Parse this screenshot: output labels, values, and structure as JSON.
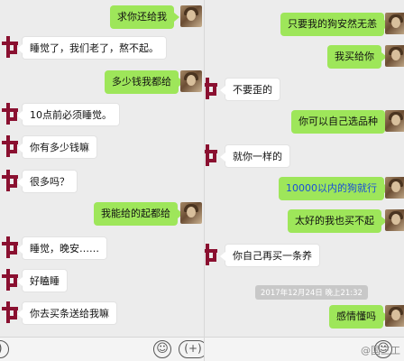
{
  "left_pane": {
    "messages": [
      {
        "from": "me",
        "text": "求你还给我"
      },
      {
        "from": "her",
        "text": "睡觉了，我们老了，熬不起。"
      },
      {
        "from": "me",
        "text": "多少钱我都给"
      },
      {
        "from": "her",
        "text": "10点前必须睡觉。"
      },
      {
        "from": "her",
        "text": "你有多少钱嘛"
      },
      {
        "from": "her",
        "text": "很多吗？"
      },
      {
        "from": "me",
        "text": "我能给的起都给"
      },
      {
        "from": "her",
        "text": "睡觉，晚安……"
      },
      {
        "from": "her",
        "text": "好瞌睡"
      },
      {
        "from": "her",
        "text": "你去买条送给我嘛"
      }
    ]
  },
  "right_pane": {
    "messages": [
      {
        "from": "me",
        "text": "只要我的狗安然无恙"
      },
      {
        "from": "me",
        "text": "我买给你"
      },
      {
        "from": "her",
        "text": "不要歪的"
      },
      {
        "from": "me",
        "text": "你可以自己选品种"
      },
      {
        "from": "her",
        "text": "就你一样的"
      },
      {
        "from": "me",
        "text": "10000以内的狗就行",
        "highlight_prefix": "10000"
      },
      {
        "from": "me",
        "text": "太好的我也买不起"
      },
      {
        "from": "her",
        "text": "你自己再买一条养"
      },
      {
        "from": "me",
        "text": "感情懂吗"
      }
    ],
    "timestamp": "2017年12月24日 晚上21:32"
  },
  "input_bar": {
    "emoji_icon": "smile-icon",
    "plus_icon": "plus-icon",
    "voice_icon": "voice-icon"
  },
  "watermark": "@国三工",
  "colors": {
    "sent_bubble": "#9ee65a",
    "received_bubble": "#ffffff",
    "background": "#ececec",
    "her_avatar": "#8a1030"
  }
}
